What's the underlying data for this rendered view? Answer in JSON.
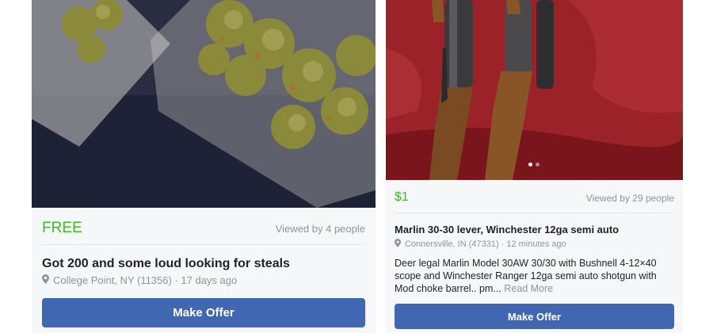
{
  "listings": [
    {
      "price": "FREE",
      "views": "Viewed by 4 people",
      "title": "Got 200 and some loud looking for steals",
      "location": "College Point, NY (11356) · 17 days ago",
      "button_label": "Make Offer",
      "icon": "location-pin-icon"
    },
    {
      "price": "$1",
      "views": "Viewed by 29 people",
      "title": "Marlin 30-30 lever, Winchester 12ga semi auto",
      "location": "Connersville, IN (47331) · 12 minutes ago",
      "description": "Deer legal Marlin Model 30AW 30/30 with Bushnell 4-12×40 scope and Winchester Ranger 12ga semi auto shotgun with Mod choke barrel.. pm...",
      "read_more": "Read More",
      "button_label": "Make Offer",
      "icon": "location-pin-icon",
      "photo_pages": 2,
      "photo_active_page": 1
    }
  ],
  "colors": {
    "price_green": "#42b72a",
    "button_blue": "#4267b2",
    "meta_gray": "#90949c",
    "text_dark": "#1d2129"
  }
}
